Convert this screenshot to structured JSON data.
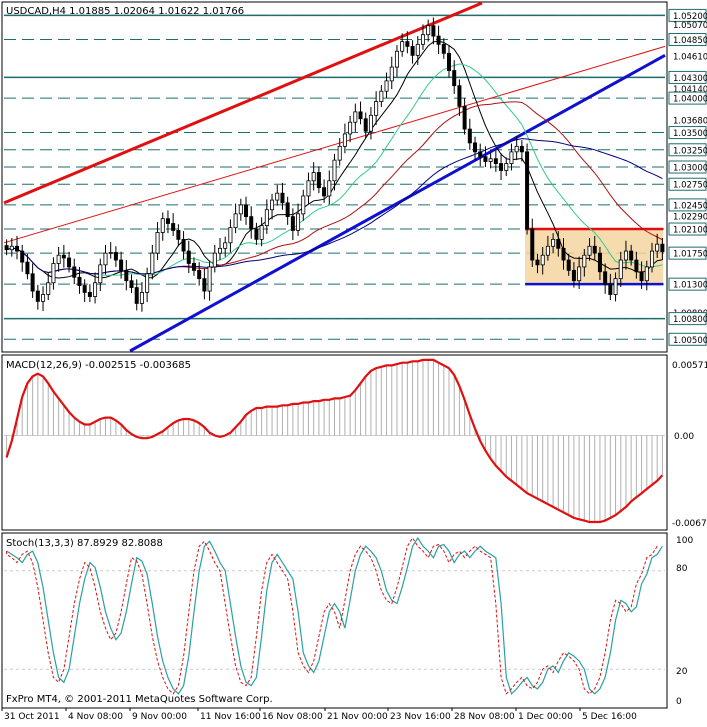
{
  "price_panel": {
    "symbol_line": "USDCAD,H4  1.01885 1.02064 1.01622 1.01766",
    "levels": [
      {
        "label": "1.05200",
        "value": 1.052,
        "boxed": true
      },
      {
        "label": "1.05070",
        "value": 1.0507,
        "boxed": false
      },
      {
        "label": "1.04850",
        "value": 1.0485,
        "boxed": true
      },
      {
        "label": "1.04610",
        "value": 1.0461,
        "boxed": false
      },
      {
        "label": "1.04300",
        "value": 1.043,
        "boxed": true
      },
      {
        "label": "1.04140",
        "value": 1.0414,
        "boxed": false
      },
      {
        "label": "1.04000",
        "value": 1.04,
        "boxed": true
      },
      {
        "label": "1.03680",
        "value": 1.0368,
        "boxed": false
      },
      {
        "label": "1.03500",
        "value": 1.035,
        "boxed": true
      },
      {
        "label": "1.03250",
        "value": 1.0325,
        "boxed": true
      },
      {
        "label": "1.03000",
        "value": 1.03,
        "boxed": true
      },
      {
        "label": "1.02750",
        "value": 1.0275,
        "boxed": true
      },
      {
        "label": "1.02450",
        "value": 1.0245,
        "boxed": true
      },
      {
        "label": "1.02290",
        "value": 1.0229,
        "boxed": false
      },
      {
        "label": "1.02100",
        "value": 1.021,
        "boxed": true
      },
      {
        "label": "1.01750",
        "value": 1.0175,
        "boxed": true
      },
      {
        "label": "1.01300",
        "value": 1.013,
        "boxed": true
      },
      {
        "label": "1.00890",
        "value": 1.0089,
        "boxed": false
      },
      {
        "label": "1.00800",
        "value": 1.008,
        "boxed": true
      },
      {
        "label": "1.00500",
        "value": 1.005,
        "boxed": true
      }
    ]
  },
  "macd_panel": {
    "title": "MACD(12,26,9) -0.002515 -0.003685",
    "ticks": [
      "0.005714",
      "0.00",
      "-0.006736"
    ]
  },
  "stoch_panel": {
    "title": "Stoch(13,3,3) 87.8929 82.8088",
    "ticks": [
      "100",
      "80",
      "20",
      "0"
    ]
  },
  "copyright": "FxPro MT4, © 2001-2011 MetaQuotes Software Corp.",
  "colors": {
    "grid_line": "#1e6e6e",
    "red": "#e01010",
    "blue": "#1010d0",
    "ma_black": "#000000",
    "ma_green": "#33cc88",
    "ma_red": "#b01010",
    "ma_navy": "#000080",
    "range_fill": "#f5d5a0",
    "stoch_main": "#2aa0a0",
    "stoch_signal": "#e01010",
    "macd_hist": "#b0b0b0"
  },
  "chart_data": {
    "type": "candlestick",
    "symbol": "USDCAD",
    "timeframe": "H4",
    "ylim": [
      1.0033,
      1.0538
    ],
    "x_ticks": [
      "31 Oct 2011",
      "4 Nov 08:00",
      "9 Nov 00:00",
      "11 Nov 16:00",
      "16 Nov 08:00",
      "21 Nov 00:00",
      "23 Nov 16:00",
      "28 Nov 08:00",
      "1 Dec 00:00",
      "5 Dec 16:00"
    ],
    "close_series": [
      1.018,
      1.0185,
      1.0178,
      1.0162,
      1.0145,
      1.012,
      1.0105,
      1.0115,
      1.0132,
      1.016,
      1.0172,
      1.0168,
      1.0155,
      1.014,
      1.0128,
      1.0118,
      1.0112,
      1.0132,
      1.0158,
      1.0175,
      1.0176,
      1.0165,
      1.015,
      1.0135,
      1.0125,
      1.0102,
      1.0118,
      1.0145,
      1.0175,
      1.0205,
      1.0225,
      1.0218,
      1.0208,
      1.0195,
      1.0178,
      1.016,
      1.015,
      1.0138,
      1.012,
      1.0155,
      1.0175,
      1.0182,
      1.019,
      1.0212,
      1.0232,
      1.0245,
      1.0228,
      1.021,
      1.0195,
      1.0215,
      1.0238,
      1.0252,
      1.0262,
      1.0248,
      1.0228,
      1.0208,
      1.0232,
      1.0258,
      1.028,
      1.0292,
      1.027,
      1.0258,
      1.028,
      1.031,
      1.033,
      1.0348,
      1.0365,
      1.038,
      1.037,
      1.0352,
      1.0375,
      1.0395,
      1.041,
      1.0425,
      1.0445,
      1.0468,
      1.0482,
      1.0475,
      1.0462,
      1.0478,
      1.0492,
      1.0505,
      1.049,
      1.0478,
      1.0465,
      1.044,
      1.0418,
      1.0388,
      1.0355,
      1.0335,
      1.0322,
      1.0315,
      1.0308,
      1.0312,
      1.0305,
      1.0295,
      1.0305,
      1.0322,
      1.033,
      1.0322,
      1.021,
      1.0165,
      1.0158,
      1.0172,
      1.0185,
      1.0195,
      1.0182,
      1.0165,
      1.015,
      1.0135,
      1.0155,
      1.0172,
      1.0185,
      1.0175,
      1.0148,
      1.013,
      1.0115,
      1.0138,
      1.0165,
      1.0178,
      1.0165,
      1.0148,
      1.0135,
      1.0155,
      1.0178,
      1.0188,
      1.0177
    ],
    "resistance_level": 1.021,
    "support_level": 1.013,
    "macd": {
      "histogram": [
        -0.0016,
        -0.0004,
        0.0012,
        0.0028,
        0.0038,
        0.0043,
        0.0045,
        0.0043,
        0.0038,
        0.0032,
        0.0027,
        0.0022,
        0.0017,
        0.0013,
        0.001,
        0.0008,
        0.0008,
        0.001,
        0.0012,
        0.0013,
        0.0013,
        0.0011,
        0.0008,
        0.0004,
        0.0001,
        -0.0001,
        -0.0002,
        -0.0002,
        -0.0001,
        0.0001,
        0.0003,
        0.0006,
        0.0009,
        0.0011,
        0.0012,
        0.0012,
        0.0011,
        0.0009,
        0.0006,
        0.0002,
        0.0,
        -0.0001,
        0.0,
        0.0002,
        0.0006,
        0.001,
        0.0015,
        0.0018,
        0.002,
        0.002,
        0.0021,
        0.0021,
        0.0021,
        0.0022,
        0.0022,
        0.0023,
        0.0023,
        0.0024,
        0.0024,
        0.0025,
        0.0025,
        0.0026,
        0.0026,
        0.0027,
        0.0027,
        0.0028,
        0.0029,
        0.0033,
        0.0038,
        0.0043,
        0.0047,
        0.0049,
        0.005,
        0.0051,
        0.0051,
        0.0052,
        0.0053,
        0.0053,
        0.0054,
        0.0054,
        0.0055,
        0.0055,
        0.0055,
        0.0053,
        0.0051,
        0.0049,
        0.0044,
        0.0036,
        0.0026,
        0.0015,
        0.0005,
        -0.0004,
        -0.0011,
        -0.0017,
        -0.0022,
        -0.0026,
        -0.003,
        -0.0033,
        -0.0036,
        -0.0039,
        -0.0042,
        -0.0044,
        -0.0046,
        -0.0048,
        -0.005,
        -0.0052,
        -0.0054,
        -0.0056,
        -0.0058,
        -0.006,
        -0.0061,
        -0.0062,
        -0.0063,
        -0.0063,
        -0.0063,
        -0.0062,
        -0.006,
        -0.0058,
        -0.0055,
        -0.0052,
        -0.0048,
        -0.0045,
        -0.0042,
        -0.0039,
        -0.0036,
        -0.0033,
        -0.0029
      ],
      "signal": [
        -0.0016,
        -0.0004,
        0.0012,
        0.0028,
        0.0038,
        0.0043,
        0.0045,
        0.0043,
        0.0038,
        0.0032,
        0.0027,
        0.0022,
        0.0017,
        0.0013,
        0.001,
        0.0008,
        0.0008,
        0.001,
        0.0012,
        0.0013,
        0.0013,
        0.0011,
        0.0008,
        0.0004,
        0.0001,
        -0.0001,
        -0.0002,
        -0.0002,
        -0.0001,
        0.0001,
        0.0003,
        0.0006,
        0.0009,
        0.0011,
        0.0012,
        0.0012,
        0.0011,
        0.0009,
        0.0006,
        0.0002,
        0.0,
        -0.0001,
        0.0,
        0.0002,
        0.0006,
        0.001,
        0.0015,
        0.0018,
        0.002,
        0.002,
        0.0021,
        0.0021,
        0.0021,
        0.0022,
        0.0022,
        0.0023,
        0.0023,
        0.0024,
        0.0024,
        0.0025,
        0.0025,
        0.0026,
        0.0026,
        0.0027,
        0.0027,
        0.0028,
        0.0029,
        0.0033,
        0.0038,
        0.0043,
        0.0047,
        0.0049,
        0.005,
        0.0051,
        0.0051,
        0.0052,
        0.0053,
        0.0053,
        0.0054,
        0.0054,
        0.0055,
        0.0055,
        0.0055,
        0.0053,
        0.0051,
        0.0049,
        0.0044,
        0.0036,
        0.0026,
        0.0015,
        0.0005,
        -0.0004,
        -0.0011,
        -0.0017,
        -0.0022,
        -0.0026,
        -0.003,
        -0.0033,
        -0.0036,
        -0.0039,
        -0.0042,
        -0.0044,
        -0.0046,
        -0.0048,
        -0.005,
        -0.0052,
        -0.0054,
        -0.0056,
        -0.0058,
        -0.006,
        -0.0061,
        -0.0062,
        -0.0063,
        -0.0063,
        -0.0063,
        -0.0062,
        -0.006,
        -0.0058,
        -0.0055,
        -0.0052,
        -0.0048,
        -0.0045,
        -0.0042,
        -0.0039,
        -0.0036,
        -0.0033,
        -0.0029
      ],
      "ylim": [
        -0.006736,
        0.005714
      ]
    },
    "stochastic": {
      "main": [
        92,
        90,
        88,
        85,
        90,
        92,
        85,
        70,
        50,
        30,
        15,
        12,
        20,
        40,
        60,
        75,
        85,
        82,
        70,
        55,
        45,
        38,
        42,
        55,
        72,
        88,
        86,
        78,
        60,
        40,
        25,
        15,
        8,
        5,
        10,
        28,
        55,
        80,
        95,
        98,
        92,
        85,
        80,
        60,
        40,
        22,
        12,
        10,
        15,
        40,
        68,
        85,
        90,
        85,
        80,
        75,
        55,
        30,
        22,
        18,
        25,
        40,
        55,
        60,
        55,
        45,
        62,
        80,
        90,
        95,
        92,
        88,
        80,
        68,
        62,
        60,
        70,
        82,
        95,
        100,
        95,
        92,
        88,
        95,
        96,
        92,
        85,
        90,
        92,
        88,
        92,
        95,
        92,
        90,
        88,
        60,
        15,
        5,
        8,
        12,
        15,
        10,
        8,
        12,
        20,
        22,
        18,
        25,
        30,
        28,
        25,
        20,
        8,
        5,
        8,
        15,
        30,
        50,
        62,
        60,
        55,
        58,
        72,
        78,
        88,
        90,
        95
      ],
      "signal": [
        92,
        90,
        88,
        85,
        90,
        92,
        85,
        70,
        50,
        30,
        15,
        12,
        20,
        40,
        60,
        75,
        85,
        82,
        70,
        55,
        45,
        38,
        42,
        55,
        72,
        88,
        86,
        78,
        60,
        40,
        25,
        15,
        8,
        5,
        10,
        28,
        55,
        80,
        95,
        98,
        92,
        85,
        80,
        60,
        40,
        22,
        12,
        10,
        15,
        40,
        68,
        85,
        90,
        85,
        80,
        75,
        55,
        30,
        22,
        18,
        25,
        40,
        55,
        60,
        55,
        45,
        62,
        80,
        90,
        95,
        92,
        88,
        80,
        68,
        62,
        60,
        70,
        82,
        95,
        100,
        95,
        92,
        88,
        95,
        96,
        92,
        85,
        90,
        92,
        88,
        92,
        95,
        92,
        90,
        88,
        60,
        15,
        5,
        8,
        12,
        15,
        10,
        8,
        12,
        20,
        22,
        18,
        25,
        30,
        28,
        25,
        20,
        8,
        5,
        8,
        15,
        30,
        50,
        62,
        60,
        55,
        58,
        72,
        78,
        88,
        90,
        95
      ],
      "ylim": [
        0,
        100
      ]
    }
  }
}
